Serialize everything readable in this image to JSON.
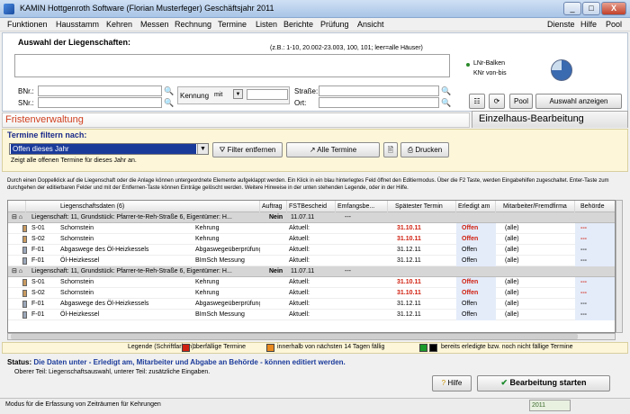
{
  "window": {
    "title": "KAMIN  Hottgenroth Software (Florian Musterfeger)    Geschäftsjahr 2011",
    "min": "_",
    "max": "□",
    "close": "X"
  },
  "menu": {
    "left": [
      "Funktionen",
      "Hausstamm",
      "Kehren",
      "Messen",
      "Rechnung",
      "Termine",
      "Listen",
      "Berichte",
      "Prüfung",
      "Ansicht"
    ],
    "right": [
      "Dienste",
      "Hilfe",
      "Pool"
    ]
  },
  "selection": {
    "title": "Auswahl der Liegenschaften:",
    "hint": "(z.B.: 1-10, 20.002-23.003, 100, 101; leer=alle Häuser)",
    "legend_1": "LNr-Balken",
    "legend_2": "KNr von-bis",
    "bnr_label": "BNr.:",
    "snr_label": "SNr.:",
    "kennung_label": "Kennung",
    "mit_value": "mit",
    "strasse_label": "Straße:",
    "ort_label": "Ort:",
    "pool_label": "Pool",
    "show_label": "Auswahl anzeigen"
  },
  "tabs": {
    "fristen": "Fristenverwaltung",
    "einzel": "Einzelhaus-Bearbeitung"
  },
  "filter": {
    "title": "Termine filtern nach:",
    "selected": "Offen dieses Jahr",
    "remove_label": "Filter entfernen",
    "all_label": "Alle Termine",
    "print_label": "Drucken",
    "description": "Zeigt alle offenen Termine für dieses Jahr an."
  },
  "info_text": "Durch einen  Doppelklick auf die Liegenschaft oder die Anlage können untergeordnete Elemente aufgeklappt werden. Ein Klick in ein blau hinterlegtes Feld öffnet den Editiermodus. Über die F2 Taste, werden Eingabehilfen zugeschaltet. Enter-Taste zum durchgehen der editierbaren Felder und mit der Entfernen-Taste können Einträge gelöscht werden. Weitere Hinweise in der unten stehenden Legende, oder in der Hilfe.",
  "grid": {
    "headers": [
      "Liegenschaftsdaten (6)",
      "Auftrag",
      "FSTBescheid",
      "Emfangsbe...",
      "Spätester Termin",
      "Erledigt am",
      "Mitarbeiter/Fremdfirma",
      "Behörde"
    ],
    "groups": [
      {
        "label": "Liegenschaft: 11, Grundstück: Pfarrer-te-Reh-Straße 6, Eigentümer:  H...",
        "auftrag": "Nein",
        "fst": "11.07.11",
        "emp": "---",
        "rows": [
          {
            "code": "S-01",
            "name": "Schornstein",
            "type": "Kehrung",
            "fst": "Aktuell:",
            "termin": "31.10.11",
            "overdue": true,
            "status": "Offen",
            "mit": "(alle)",
            "beh": "---"
          },
          {
            "code": "S-02",
            "name": "Schornstein",
            "type": "Kehrung",
            "fst": "Aktuell:",
            "termin": "31.10.11",
            "overdue": true,
            "status": "Offen",
            "mit": "(alle)",
            "beh": "---"
          },
          {
            "code": "F-01",
            "name": "Abgaswege des Öl-Heizkessels",
            "type": "Abgaswegeüberprüfung",
            "fst": "Aktuell:",
            "termin": "31.12.11",
            "overdue": false,
            "status": "Offen",
            "mit": "(alle)",
            "beh": "---"
          },
          {
            "code": "F-01",
            "name": "Öl-Heizkessel",
            "type": "BImSch Messung",
            "fst": "Aktuell:",
            "termin": "31.12.11",
            "overdue": false,
            "status": "Offen",
            "mit": "(alle)",
            "beh": "---"
          }
        ]
      },
      {
        "label": "Liegenschaft: 11, Grundstück: Pfarrer-te-Reh-Straße 6, Eigentümer:  H...",
        "auftrag": "Nein",
        "fst": "11.07.11",
        "emp": "---",
        "rows": [
          {
            "code": "S-01",
            "name": "Schornstein",
            "type": "Kehrung",
            "fst": "Aktuell:",
            "termin": "31.10.11",
            "overdue": true,
            "status": "Offen",
            "mit": "(alle)",
            "beh": "---"
          },
          {
            "code": "S-02",
            "name": "Schornstein",
            "type": "Kehrung",
            "fst": "Aktuell:",
            "termin": "31.10.11",
            "overdue": true,
            "status": "Offen",
            "mit": "(alle)",
            "beh": "---"
          },
          {
            "code": "F-01",
            "name": "Abgaswege des Öl-Heizkessels",
            "type": "Abgaswegeüberprüfung",
            "fst": "Aktuell:",
            "termin": "31.12.11",
            "overdue": false,
            "status": "Offen",
            "mit": "(alle)",
            "beh": "---"
          },
          {
            "code": "F-01",
            "name": "Öl-Heizkessel",
            "type": "BImSch Messung",
            "fst": "Aktuell:",
            "termin": "31.12.11",
            "overdue": false,
            "status": "Offen",
            "mit": "(alle)",
            "beh": "---"
          }
        ]
      }
    ]
  },
  "legend": {
    "title": "Legende (Schriftfarben):",
    "item1": "überfällige Termine",
    "item2": "innerhalb von nächsten 14 Tagen fällig",
    "item3": "bereits erledigte bzw. noch nicht fällige Termine",
    "colors": {
      "overdue": "#d02010",
      "soon": "#e88a20",
      "done": "#1a9a2a",
      "notdue": "#000000"
    }
  },
  "status": {
    "label": "Status:",
    "text": "Die Daten unter - Erledigt am, Mitarbeiter und Abgabe an Behörde - können editiert werden.",
    "sub": "Oberer Teil: Liegenschaftsauswahl,  unterer Teil: zusätzliche Eingaben."
  },
  "actions": {
    "hilfe": "Hilfe",
    "start": "Bearbeitung starten"
  },
  "bottom": {
    "text": "Modus für die Erfassung von Zeiträumen für Kehrungen",
    "year": "2011"
  }
}
